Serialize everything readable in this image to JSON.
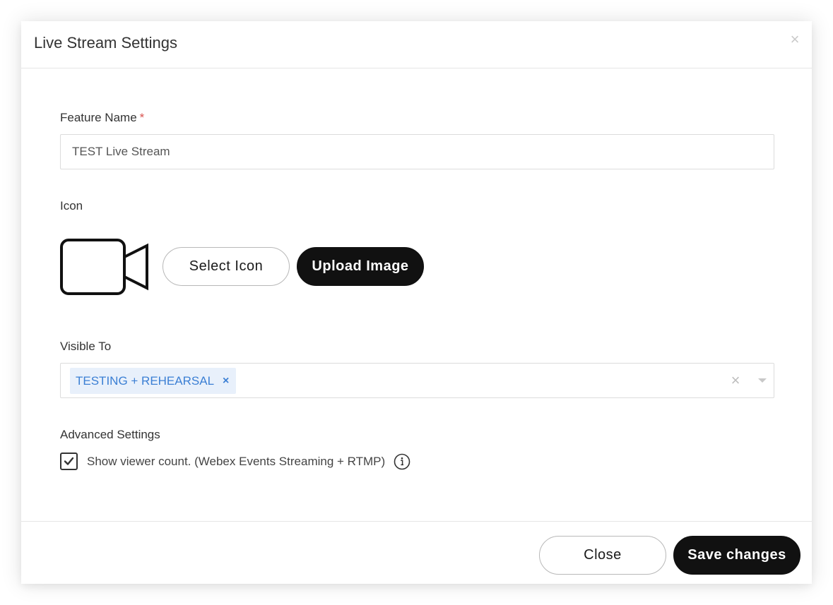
{
  "modal": {
    "title": "Live Stream Settings",
    "close_glyph": "×"
  },
  "feature_name": {
    "label": "Feature Name",
    "required_mark": "*",
    "value": "TEST Live Stream"
  },
  "icon_section": {
    "label": "Icon",
    "preview_icon": "video-camera-icon",
    "select_label": "Select Icon",
    "upload_label": "Upload Image"
  },
  "visible_to": {
    "label": "Visible To",
    "selected": [
      "TESTING + REHEARSAL"
    ],
    "remove_glyph": "×",
    "clear_glyph": "×"
  },
  "advanced": {
    "label": "Advanced Settings",
    "viewer_count_label": "Show viewer count. (Webex Events Streaming + RTMP)",
    "viewer_count_checked": true,
    "info_icon": "info-icon"
  },
  "footer": {
    "close_label": "Close",
    "save_label": "Save changes"
  },
  "colors": {
    "primary_button": "#111111",
    "tag_text": "#3b7fd4",
    "tag_background": "#e8f0fb",
    "required": "#d9534f"
  }
}
